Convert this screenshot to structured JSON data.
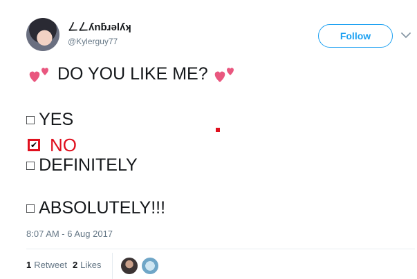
{
  "author": {
    "display_name": "ㄥㄥʎnƃɹǝlʎʞ",
    "handle": "@Kylerguy77"
  },
  "follow_button": {
    "label": "Follow"
  },
  "tweet": {
    "question": "DO YOU LIKE ME?",
    "options": [
      {
        "box": "□",
        "label": "YES",
        "checked": false
      },
      {
        "box": "✔",
        "label": "NO",
        "checked": true
      },
      {
        "box": "□",
        "label": "DEFINITELY",
        "checked": false
      },
      {
        "box": "□",
        "label": "ABSOLUTELY!!!",
        "checked": false
      }
    ],
    "timestamp": "8:07 AM - 6 Aug 2017"
  },
  "stats": {
    "retweets_count": "1",
    "retweets_label": "Retweet",
    "likes_count": "2",
    "likes_label": "Likes"
  },
  "colors": {
    "accent": "#1da1f2",
    "check_red": "#e0101e",
    "heart_pink": "#e9577f",
    "muted": "#657786"
  },
  "icons": {
    "heart": "two-hearts-icon",
    "menu": "chevron-down-icon"
  }
}
